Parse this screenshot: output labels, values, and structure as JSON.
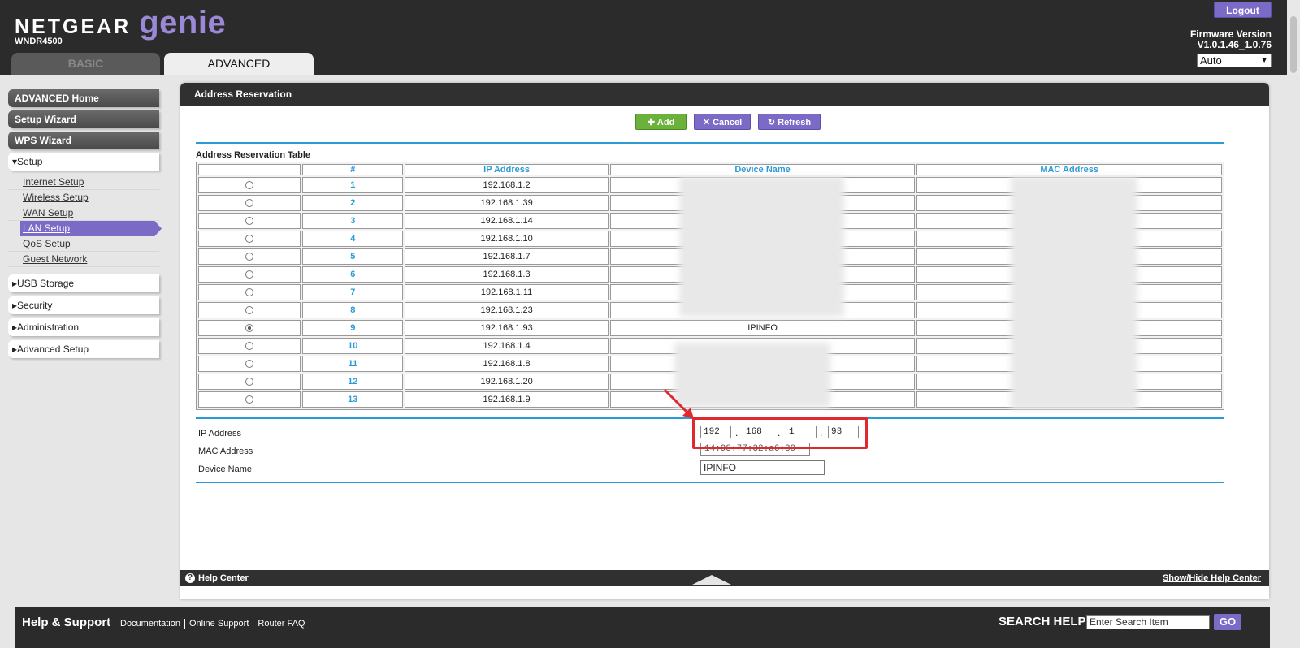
{
  "header": {
    "brand_name": "NETGEAR",
    "brand_product": "genie",
    "model": "WNDR4500",
    "tabs": [
      {
        "label": "BASIC"
      },
      {
        "label": "ADVANCED"
      }
    ],
    "logout_label": "Logout",
    "firmware_label": "Firmware Version",
    "firmware_version": "V1.0.1.46_1.0.76",
    "language_selected": "Auto"
  },
  "sidebar": {
    "primary": [
      {
        "label": "ADVANCED Home"
      },
      {
        "label": "Setup Wizard"
      },
      {
        "label": "WPS Wizard"
      }
    ],
    "setup": {
      "label": "▾Setup",
      "items": [
        {
          "label": "Internet Setup"
        },
        {
          "label": "Wireless Setup"
        },
        {
          "label": "WAN Setup"
        },
        {
          "label": "LAN Setup"
        },
        {
          "label": "QoS Setup"
        },
        {
          "label": "Guest Network"
        }
      ]
    },
    "sections": [
      {
        "label": "▸USB Storage"
      },
      {
        "label": "▸Security"
      },
      {
        "label": "▸Administration"
      },
      {
        "label": "▸Advanced Setup"
      }
    ]
  },
  "panel": {
    "title": "Address Reservation",
    "buttons": {
      "add": "Add",
      "cancel": "Cancel",
      "refresh": "Refresh"
    },
    "table_title": "Address Reservation Table",
    "columns": [
      "",
      "#",
      "IP Address",
      "Device Name",
      "MAC Address"
    ],
    "rows": [
      {
        "num": "1",
        "ip": "192.168.1.2",
        "device": "",
        "mac": "",
        "selected": false
      },
      {
        "num": "2",
        "ip": "192.168.1.39",
        "device": "",
        "mac": "",
        "selected": false
      },
      {
        "num": "3",
        "ip": "192.168.1.14",
        "device": "",
        "mac": "",
        "selected": false
      },
      {
        "num": "4",
        "ip": "192.168.1.10",
        "device": "",
        "mac": "",
        "selected": false
      },
      {
        "num": "5",
        "ip": "192.168.1.7",
        "device": "",
        "mac": "",
        "selected": false
      },
      {
        "num": "6",
        "ip": "192.168.1.3",
        "device": "",
        "mac": "",
        "selected": false
      },
      {
        "num": "7",
        "ip": "192.168.1.11",
        "device": "",
        "mac": "",
        "selected": false
      },
      {
        "num": "8",
        "ip": "192.168.1.23",
        "device": "",
        "mac": "",
        "selected": false
      },
      {
        "num": "9",
        "ip": "192.168.1.93",
        "device": "IPINFO",
        "mac": "",
        "selected": true
      },
      {
        "num": "10",
        "ip": "192.168.1.4",
        "device": "",
        "mac": "",
        "selected": false
      },
      {
        "num": "11",
        "ip": "192.168.1.8",
        "device": "",
        "mac": "",
        "selected": false
      },
      {
        "num": "12",
        "ip": "192.168.1.20",
        "device": "",
        "mac": "",
        "selected": false
      },
      {
        "num": "13",
        "ip": "192.168.1.9",
        "device": "",
        "mac": "",
        "selected": false
      }
    ],
    "form": {
      "ip_label": "IP Address",
      "ip_octets": [
        "192",
        "168",
        "1",
        "93"
      ],
      "mac_label": "MAC Address",
      "mac_value": "14:98:77:32:a6:89",
      "name_label": "Device Name",
      "name_value": "IPINFO"
    },
    "highlight_color": "#e0282e"
  },
  "help_bar": {
    "help_center": "Help Center",
    "toggle": "Show/Hide Help Center"
  },
  "footer": {
    "title": "Help & Support",
    "links": [
      "Documentation",
      "Online Support",
      "Router FAQ"
    ],
    "search_label": "SEARCH HELP",
    "search_placeholder": "Enter Search Item",
    "go_label": "GO"
  },
  "colors": {
    "accent_purple": "#7b6bc7",
    "accent_green": "#6bb23c",
    "accent_blue": "#2b9bd6",
    "dark_bar": "#2b2b2b"
  }
}
